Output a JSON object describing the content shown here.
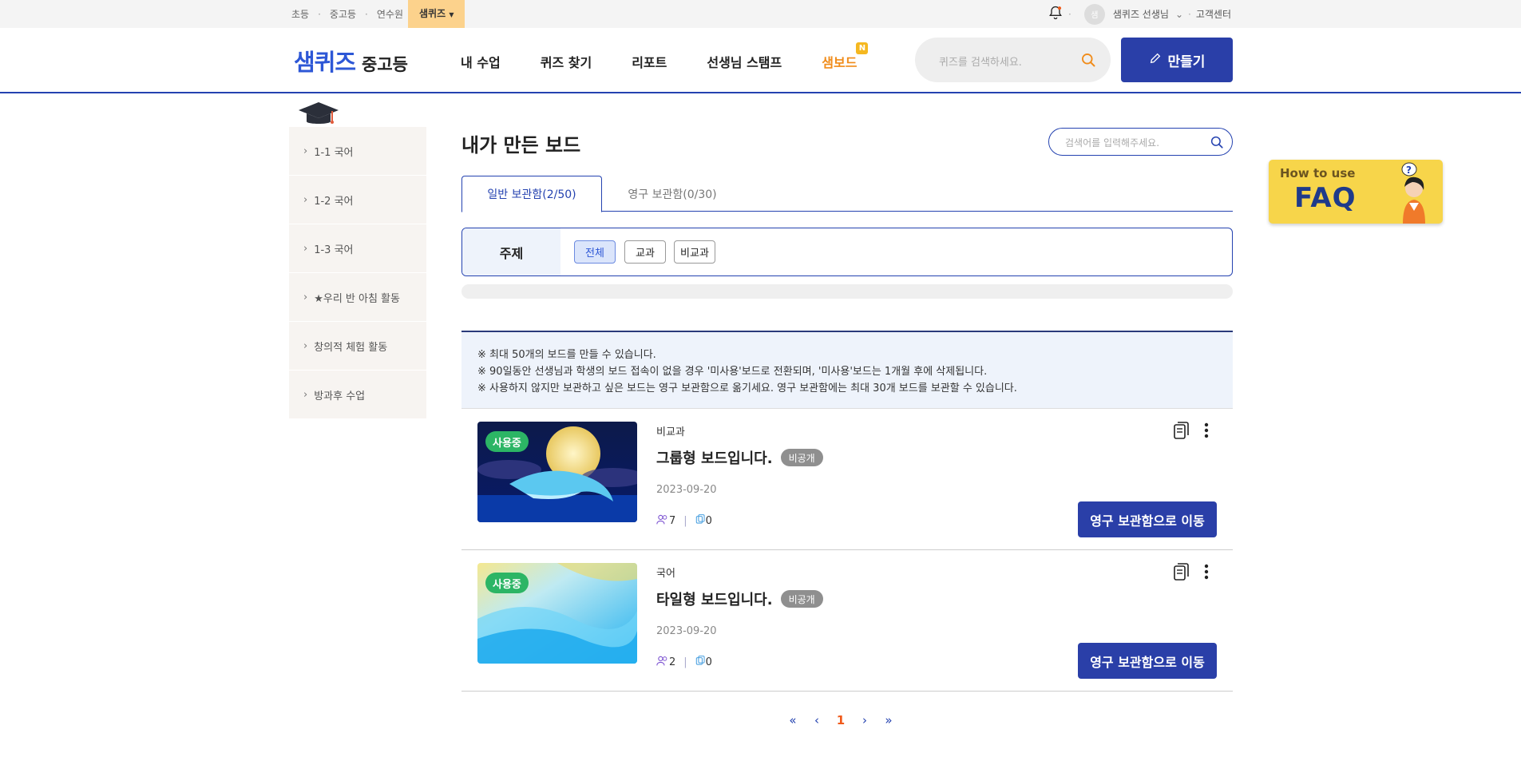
{
  "topbar": {
    "links": [
      "초등",
      "중고등",
      "연수원"
    ],
    "active_link": "샘퀴즈",
    "user_name": "샘퀴즈 선생님",
    "avatar_initial": "샘",
    "help": "고객센터"
  },
  "header": {
    "logo_main": "샘퀴즈",
    "logo_sub": "중고등",
    "nav": [
      "내 수업",
      "퀴즈 찾기",
      "리포트",
      "선생님 스탬프"
    ],
    "nav_highlight": "샘보드",
    "new_badge": "N",
    "search_placeholder": "퀴즈를 검색하세요.",
    "make_label": "만들기"
  },
  "sidebar": {
    "items": [
      {
        "label": "1-1 국어"
      },
      {
        "label": "1-2 국어"
      },
      {
        "label": "1-3 국어"
      },
      {
        "label": "★우리 반 아침 활동"
      },
      {
        "label": "창의적 체험 활동"
      },
      {
        "label": "방과후 수업"
      }
    ]
  },
  "main": {
    "title": "내가 만든 보드",
    "search_placeholder": "검색어를 입력해주세요.",
    "tabs": [
      {
        "label": "일반 보관함(2/50)"
      },
      {
        "label": "영구 보관함(0/30)"
      }
    ],
    "filter": {
      "label": "주제",
      "chips": [
        "전체",
        "교과",
        "비교과"
      ]
    },
    "notice": [
      "※ 최대 50개의 보드를 만들 수 있습니다.",
      "※ 90일동안 선생님과 학생의 보드 접속이 없을 경우 '미사용'보드로 전환되며, '미사용'보드는 1개월 후에 삭제됩니다.",
      "※ 사용하지 않지만 보관하고 싶은 보드는 영구 보관함으로 옮기세요. 영구 보관함에는 최대 30개 보드를 보관할 수 있습니다."
    ],
    "boards": [
      {
        "status": "사용중",
        "category": "비교과",
        "title": "그룹형 보드입니다.",
        "visibility": "비공개",
        "date": "2023-09-20",
        "members": "7",
        "posts": "0",
        "move_label": "영구 보관함으로 이동"
      },
      {
        "status": "사용중",
        "category": "국어",
        "title": "타일형 보드입니다.",
        "visibility": "비공개",
        "date": "2023-09-20",
        "members": "2",
        "posts": "0",
        "move_label": "영구 보관함으로 이동"
      }
    ],
    "pagination": {
      "first": "«",
      "prev": "‹",
      "current": "1",
      "next": "›",
      "last": "»"
    }
  },
  "faq": {
    "line1": "How to use",
    "line2": "FAQ"
  },
  "colors": {
    "primary": "#2a3fa8",
    "accent_orange": "#f08c1a",
    "status_green": "#2cb565"
  }
}
